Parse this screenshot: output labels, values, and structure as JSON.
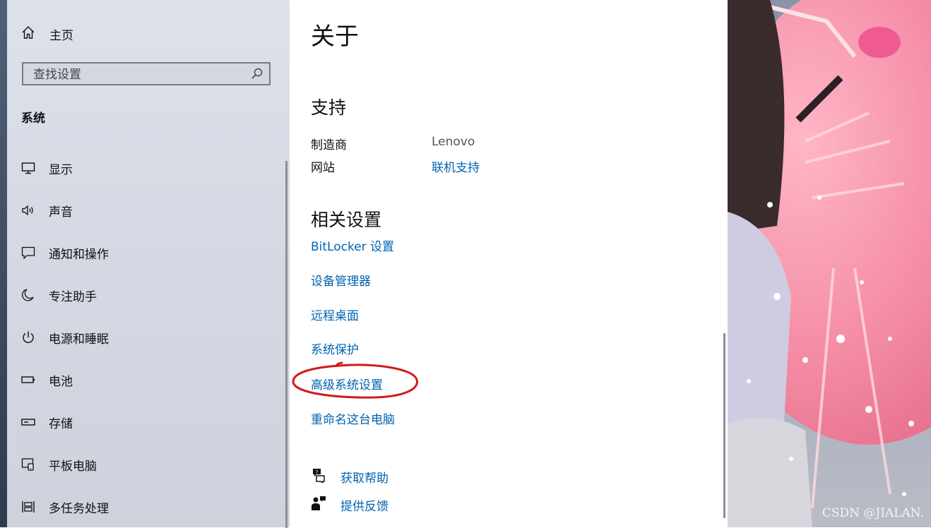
{
  "sidebar": {
    "home": {
      "label": "主页",
      "icon": "home-icon"
    },
    "search": {
      "placeholder": "查找设置",
      "icon": "search-icon"
    },
    "section_title": "系统",
    "items": [
      {
        "label": "显示",
        "icon": "display-icon"
      },
      {
        "label": "声音",
        "icon": "speaker-icon"
      },
      {
        "label": "通知和操作",
        "icon": "notification-icon"
      },
      {
        "label": "专注助手",
        "icon": "moon-icon"
      },
      {
        "label": "电源和睡眠",
        "icon": "power-icon"
      },
      {
        "label": "电池",
        "icon": "battery-icon"
      },
      {
        "label": "存储",
        "icon": "storage-icon"
      },
      {
        "label": "平板电脑",
        "icon": "tablet-icon"
      },
      {
        "label": "多任务处理",
        "icon": "multitask-icon"
      }
    ]
  },
  "content": {
    "title": "关于",
    "support": {
      "heading": "支持",
      "manufacturer_label": "制造商",
      "manufacturer_value": "Lenovo",
      "website_label": "网站",
      "website_link": "联机支持"
    },
    "related": {
      "heading": "相关设置",
      "links": [
        "BitLocker 设置",
        "设备管理器",
        "远程桌面",
        "系统保护",
        "高级系统设置",
        "重命名这台电脑"
      ]
    },
    "help": [
      {
        "label": "获取帮助",
        "icon": "help-chat-icon"
      },
      {
        "label": "提供反馈",
        "icon": "feedback-icon"
      }
    ],
    "annotation_color": "#d11a1a"
  },
  "wallpaper": {
    "watermark": "CSDN @JIALAN."
  },
  "colors": {
    "link": "#0063b1",
    "sidebar_bg": "#d8dce5",
    "text": "#111111"
  }
}
